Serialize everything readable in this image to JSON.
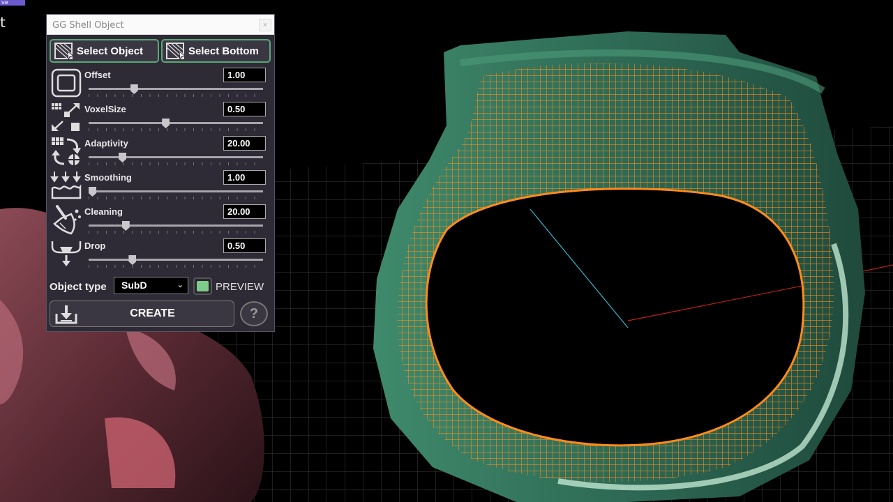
{
  "app": {
    "badge": "ve",
    "side_text": "t"
  },
  "panel": {
    "title": "GG Shell Object",
    "close_label": "×",
    "select_object_label": "Select Object",
    "select_bottom_label": "Select Bottom",
    "params": [
      {
        "label": "Offset",
        "value": "1.00",
        "slider_fraction": 0.25,
        "icon": "offset-icon"
      },
      {
        "label": "VoxelSize",
        "value": "0.50",
        "slider_fraction": 0.44,
        "icon": "voxel-size-icon"
      },
      {
        "label": "Adaptivity",
        "value": "20.00",
        "slider_fraction": 0.18,
        "icon": "adaptivity-icon"
      },
      {
        "label": "Smoothing",
        "value": "1.00",
        "slider_fraction": 0.0,
        "icon": "smoothing-icon"
      },
      {
        "label": "Cleaning",
        "value": "20.00",
        "slider_fraction": 0.2,
        "icon": "cleaning-brush-icon"
      },
      {
        "label": "Drop",
        "value": "0.50",
        "slider_fraction": 0.24,
        "icon": "drop-icon"
      }
    ],
    "object_type_label": "Object type",
    "object_type_value": "SubD",
    "preview_label": "PREVIEW",
    "create_label": "CREATE",
    "help_label": "?"
  },
  "colors": {
    "panel_bg": "#2f2b36",
    "accent_green": "#5aa878",
    "preview_checked": "#7ecb8a",
    "wireframe": "#ff8c1a",
    "ring_shell": "#2e6a55"
  }
}
